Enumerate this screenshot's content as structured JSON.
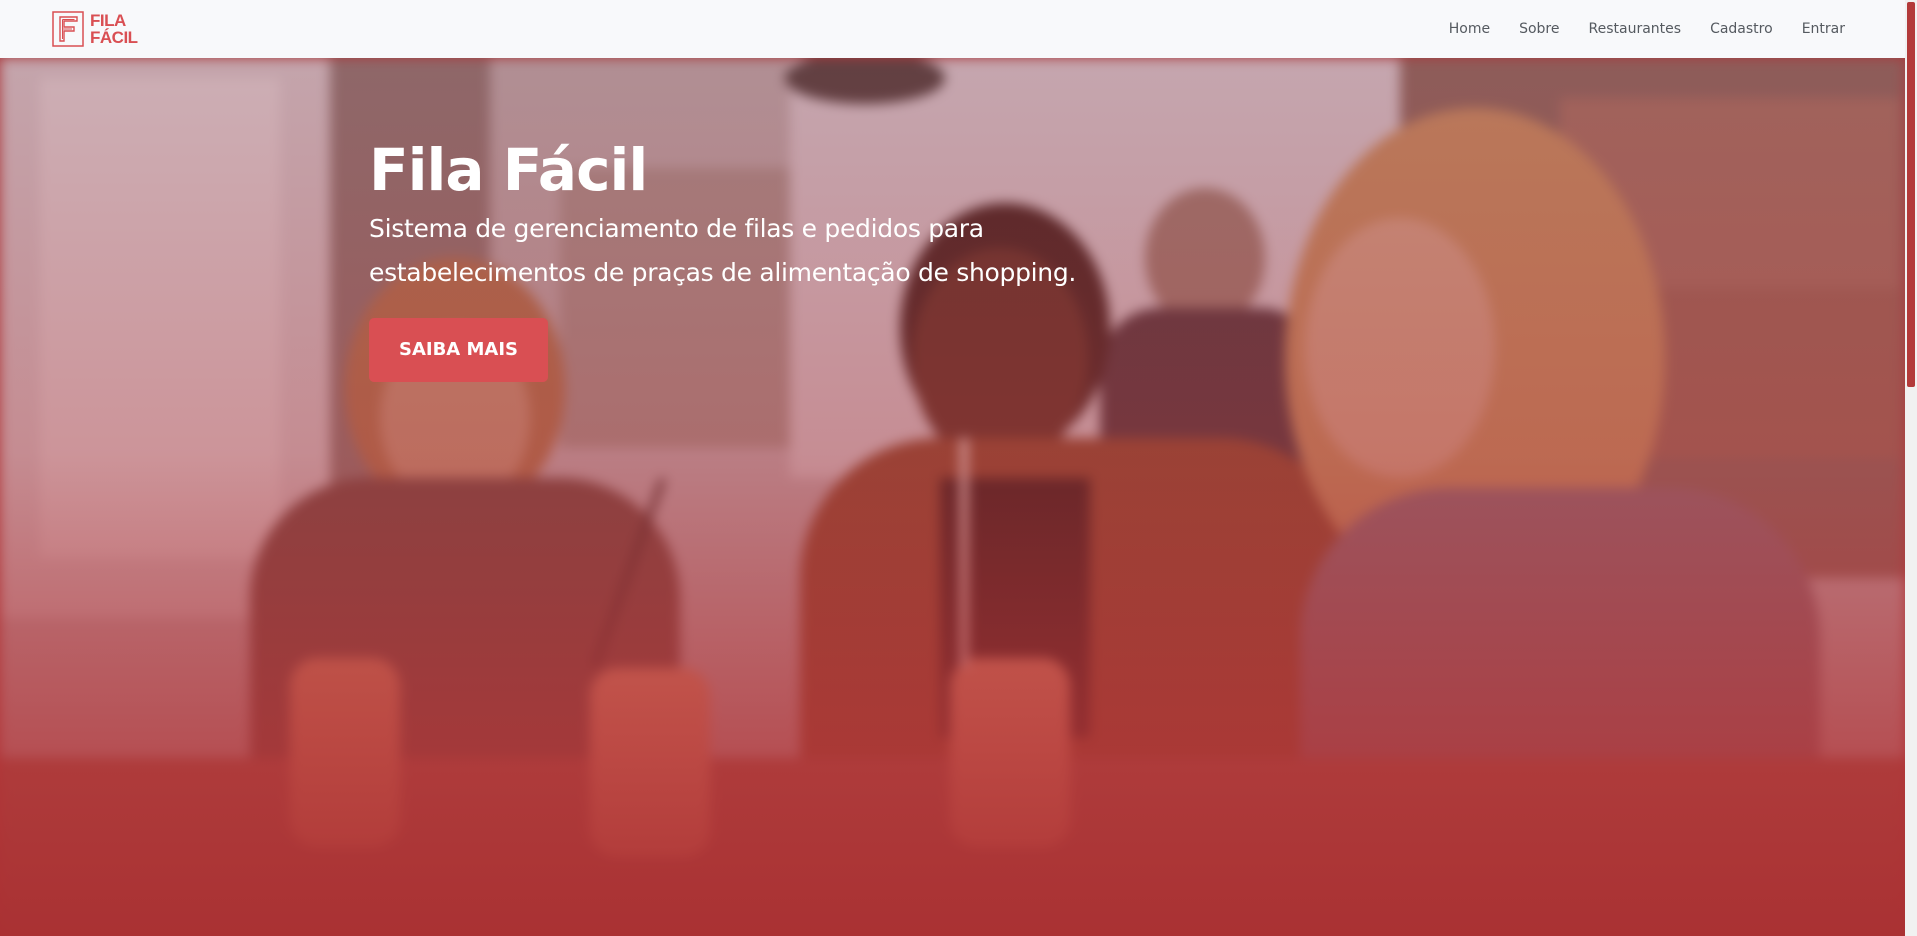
{
  "brand": {
    "line1": "FILA",
    "line2": "FÁCIL",
    "logo_icon": "fila-facil-logo-icon",
    "color": "#d94f53"
  },
  "nav": {
    "items": [
      {
        "label": "Home"
      },
      {
        "label": "Sobre"
      },
      {
        "label": "Restaurantes"
      },
      {
        "label": "Cadastro"
      },
      {
        "label": "Entrar"
      }
    ]
  },
  "hero": {
    "title": "Fila Fácil",
    "subtitle": "Sistema de gerenciamento de filas e pedidos para estabelecimentos de praças de alimentação de shopping.",
    "button_label": "SAIBA MAIS",
    "button_color": "#d94f53",
    "overlay_color": "#b23a3a",
    "background_image": "people-at-food-court-photo"
  }
}
